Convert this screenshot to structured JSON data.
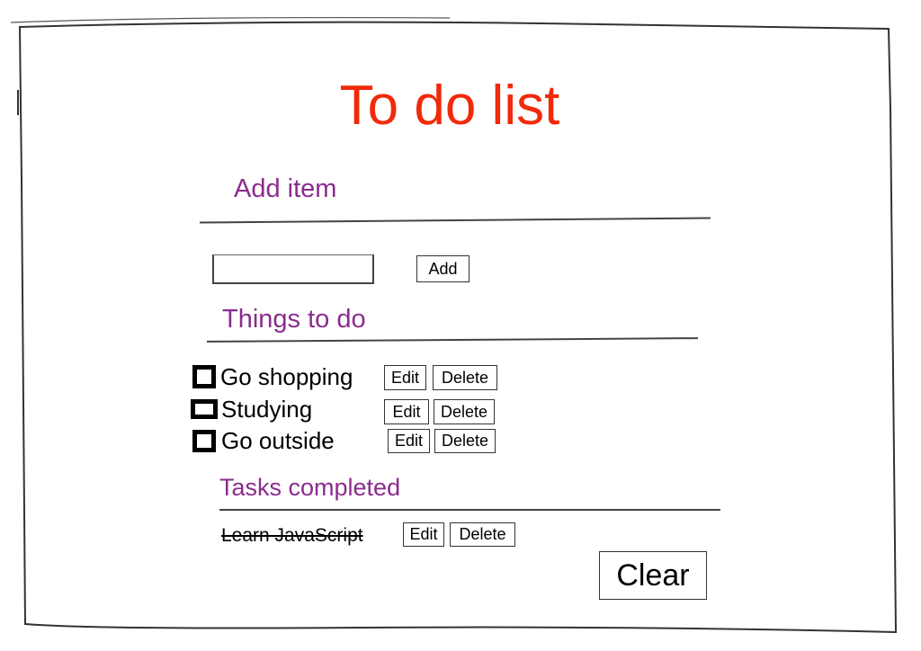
{
  "title": "To do list",
  "add_section": {
    "heading": "Add item",
    "input_value": "",
    "input_placeholder": "",
    "add_button": "Add"
  },
  "todo_section": {
    "heading": "Things to do",
    "items": [
      {
        "label": "Go shopping",
        "checked": false,
        "edit": "Edit",
        "delete": "Delete"
      },
      {
        "label": "Studying",
        "checked": false,
        "edit": "Edit",
        "delete": "Delete"
      },
      {
        "label": "Go outside",
        "checked": false,
        "edit": "Edit",
        "delete": "Delete"
      }
    ]
  },
  "completed_section": {
    "heading": "Tasks completed",
    "items": [
      {
        "label": "Learn JavaScript",
        "edit": "Edit",
        "delete": "Delete"
      }
    ]
  },
  "clear_button": "Clear",
  "colors": {
    "title": "#f02a0a",
    "heading": "#8b2c8e"
  }
}
